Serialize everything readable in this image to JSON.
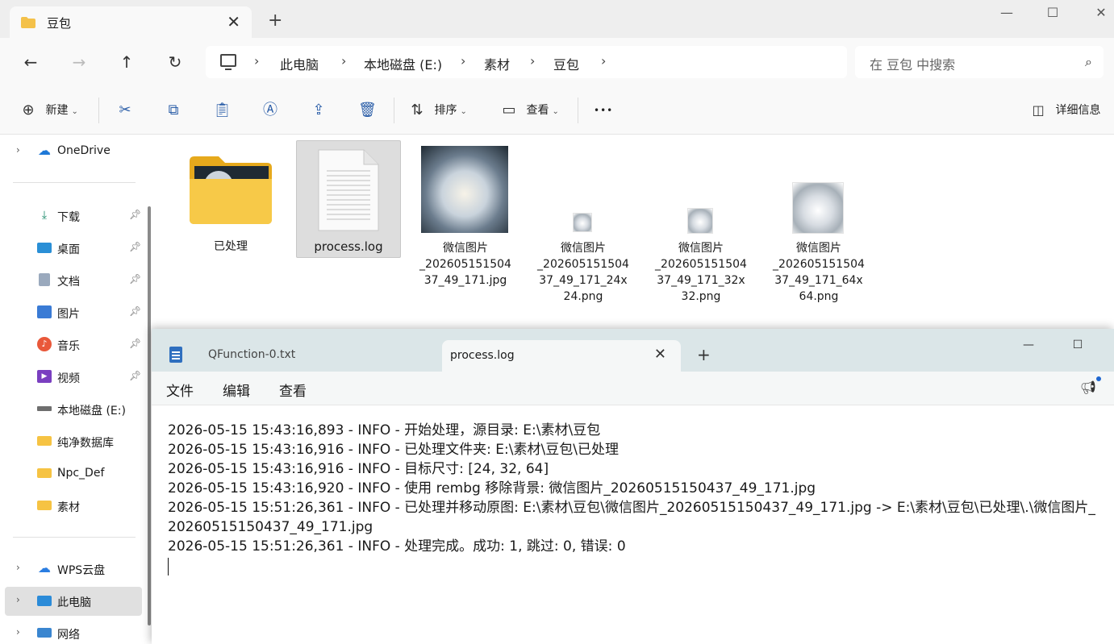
{
  "explorer": {
    "tab_title": "豆包",
    "new_tab": "+",
    "window_controls": {
      "minimize": "—",
      "maximize": "☐",
      "close": "✕"
    },
    "nav": {
      "back": "←",
      "forward": "→",
      "up": "↑",
      "refresh": "↻"
    },
    "breadcrumbs": [
      "此电脑",
      "本地磁盘 (E:)",
      "素材",
      "豆包"
    ],
    "search_placeholder": "在 豆包 中搜索",
    "toolbar": {
      "new_label": "新建",
      "sort_label": "排序",
      "view_label": "查看",
      "more_label": "•••",
      "details_label": "详细信息"
    },
    "sidebar": {
      "onedrive": "OneDrive",
      "quick": [
        {
          "label": "下载",
          "icon": "download-icon"
        },
        {
          "label": "桌面",
          "icon": "desktop-icon"
        },
        {
          "label": "文档",
          "icon": "document-icon"
        },
        {
          "label": "图片",
          "icon": "pictures-icon"
        },
        {
          "label": "音乐",
          "icon": "music-icon"
        },
        {
          "label": "视频",
          "icon": "video-icon"
        },
        {
          "label": "本地磁盘 (E:)",
          "icon": "drive-icon"
        },
        {
          "label": "纯净数据库",
          "icon": "folder-icon"
        },
        {
          "label": "Npc_Def",
          "icon": "folder-icon"
        },
        {
          "label": "素材",
          "icon": "folder-icon"
        }
      ],
      "wps": "WPS云盘",
      "this_pc": "此电脑",
      "network": "网络"
    },
    "files": [
      {
        "name": "已处理",
        "type": "folder"
      },
      {
        "name": "process.log",
        "type": "log",
        "selected": true
      },
      {
        "name_lines": [
          "微信图片",
          "_202605151504",
          "37_49_171.jpg"
        ],
        "type": "image-large"
      },
      {
        "name_lines": [
          "微信图片",
          "_202605151504",
          "37_49_171_24x",
          "24.png"
        ],
        "type": "image-24"
      },
      {
        "name_lines": [
          "微信图片",
          "_202605151504",
          "37_49_171_32x",
          "32.png"
        ],
        "type": "image-32"
      },
      {
        "name_lines": [
          "微信图片",
          "_202605151504",
          "37_49_171_64x",
          "64.png"
        ],
        "type": "image-64"
      }
    ]
  },
  "notepad": {
    "tabs": [
      "QFunction-0.txt",
      "process.log"
    ],
    "close": "✕",
    "new_tab": "+",
    "minimize": "—",
    "maximize": "☐",
    "menu": [
      "文件",
      "编辑",
      "查看"
    ],
    "lines": [
      "2026-05-15 15:43:16,893 - INFO - 开始处理，源目录: E:\\素材\\豆包",
      "2026-05-15 15:43:16,916 - INFO - 已处理文件夹: E:\\素材\\豆包\\已处理",
      "2026-05-15 15:43:16,916 - INFO - 目标尺寸: [24, 32, 64]",
      "2026-05-15 15:43:16,920 - INFO - 使用 rembg 移除背景: 微信图片_20260515150437_49_171.jpg",
      "2026-05-15 15:51:26,361 - INFO - 已处理并移动原图: E:\\素材\\豆包\\微信图片_20260515150437_49_171.jpg -> E:\\素材\\豆包\\已处理\\.\\微信图片_",
      "20260515150437_49_171.jpg",
      "2026-05-15 15:51:26,361 - INFO - 处理完成。成功: 1, 跳过: 0, 错误: 0"
    ]
  }
}
